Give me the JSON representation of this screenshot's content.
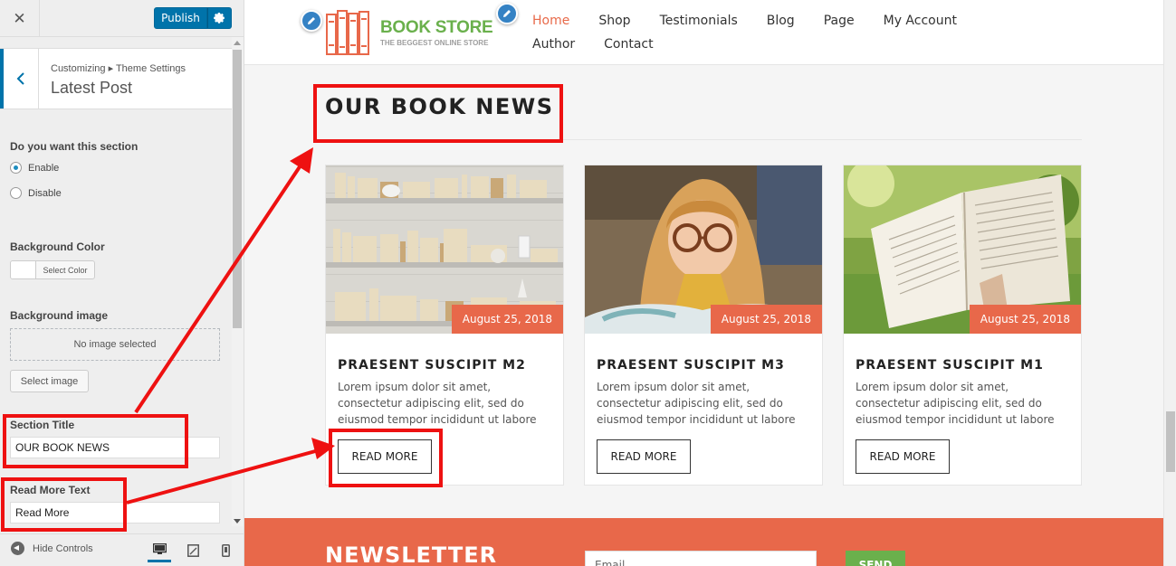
{
  "sidebar": {
    "close_icon": "close-icon",
    "publish_label": "Publish",
    "breadcrumb": "Customizing ▸ Theme Settings",
    "section_title": "Latest Post",
    "show_section_label": "Do you want this section",
    "options": [
      {
        "label": "Enable",
        "checked": true
      },
      {
        "label": "Disable",
        "checked": false
      }
    ],
    "bg_color_label": "Background Color",
    "select_color_label": "Select Color",
    "bg_image_label": "Background image",
    "no_image_text": "No image selected",
    "select_image_label": "Select image",
    "section_title_label": "Section Title",
    "section_title_value": "OUR BOOK NEWS",
    "read_more_label": "Read More Text",
    "read_more_value": "Read More",
    "hide_controls_label": "Hide Controls"
  },
  "site": {
    "logo_title": "BOOK STORE",
    "logo_tagline": "THE BEGGEST ONLINE STORE",
    "nav": [
      {
        "label": "Home",
        "active": true
      },
      {
        "label": "Shop",
        "active": false
      },
      {
        "label": "Testimonials",
        "active": false
      },
      {
        "label": "Blog",
        "active": false
      },
      {
        "label": "Page",
        "active": false
      },
      {
        "label": "My Account",
        "active": false
      },
      {
        "label": "Author",
        "active": false
      },
      {
        "label": "Contact",
        "active": false
      }
    ],
    "news_title": "OUR BOOK NEWS",
    "posts": [
      {
        "date": "August 25, 2018",
        "title": "PRAESENT SUSCIPIT M2",
        "excerpt": "Lorem ipsum dolor sit amet, consectetur adipiscing elit, sed do eiusmod tempor incididunt ut labore",
        "read_more": "READ MORE"
      },
      {
        "date": "August 25, 2018",
        "title": "PRAESENT SUSCIPIT M3",
        "excerpt": "Lorem ipsum dolor sit amet, consectetur adipiscing elit, sed do eiusmod tempor incididunt ut labore",
        "read_more": "READ MORE"
      },
      {
        "date": "August 25, 2018",
        "title": "PRAESENT SUSCIPIT M1",
        "excerpt": "Lorem ipsum dolor sit amet, consectetur adipiscing elit, sed do eiusmod tempor incididunt ut labore",
        "read_more": "READ MORE"
      }
    ],
    "newsletter_title": "NEWSLETTER",
    "email_placeholder": "Email",
    "send_label": "SEND"
  },
  "colors": {
    "accent": "#e8684a",
    "brand_green": "#6ab04c",
    "wp_blue": "#0073aa",
    "annotation_red": "#ee1111"
  }
}
